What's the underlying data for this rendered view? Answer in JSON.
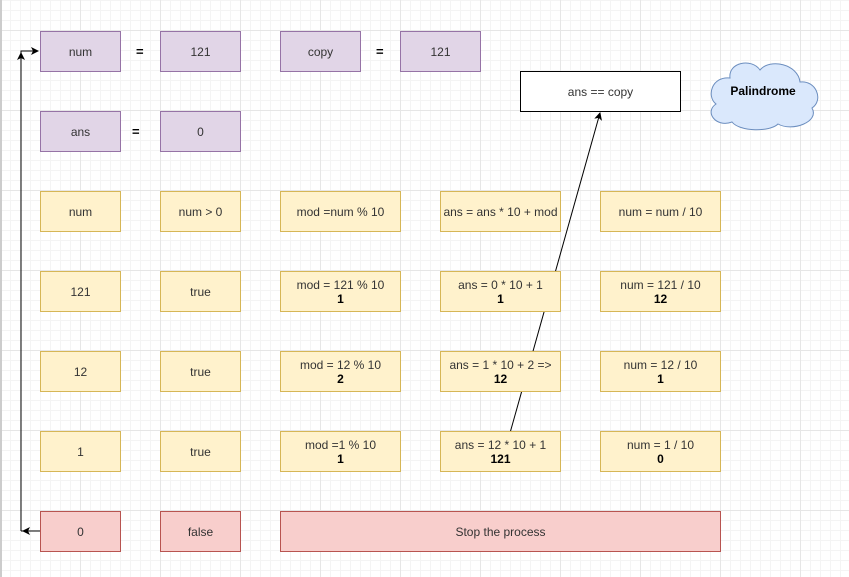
{
  "vars": {
    "num_label": "num",
    "equals": "=",
    "num_value": "121",
    "copy_label": "copy",
    "copy_value": "121",
    "ans_label": "ans",
    "ans_value": "0"
  },
  "check": {
    "condition": "ans  == copy",
    "result": "Palindrome"
  },
  "header": [
    "num",
    "num > 0",
    "mod =num % 10",
    "ans = ans * 10 + mod",
    "num = num / 10"
  ],
  "rows": [
    {
      "num": "121",
      "cond": "true",
      "mod": "mod = 121 % 10",
      "mod_val": "1",
      "ans": "ans = 0 * 10 + 1",
      "ans_val": "1",
      "div": "num = 121 / 10",
      "div_val": "12"
    },
    {
      "num": "12",
      "cond": "true",
      "mod": "mod = 12 % 10",
      "mod_val": "2",
      "ans": "ans = 1 * 10 + 2 =>",
      "ans_val": "12",
      "div": "num = 12 / 10",
      "div_val": "1"
    },
    {
      "num": "1",
      "cond": "true",
      "mod": "mod =1 % 10",
      "mod_val": "1",
      "ans": "ans = 12 * 10 + 1",
      "ans_val": "121",
      "div": "num = 1 / 10",
      "div_val": "0"
    }
  ],
  "final": {
    "num": "0",
    "cond": "false",
    "action": "Stop the process"
  },
  "colors": {
    "variable_fill": "#e1d5e7",
    "step_fill": "#fff2cc",
    "stop_fill": "#f8cecc",
    "cloud_fill": "#dae8fc"
  }
}
